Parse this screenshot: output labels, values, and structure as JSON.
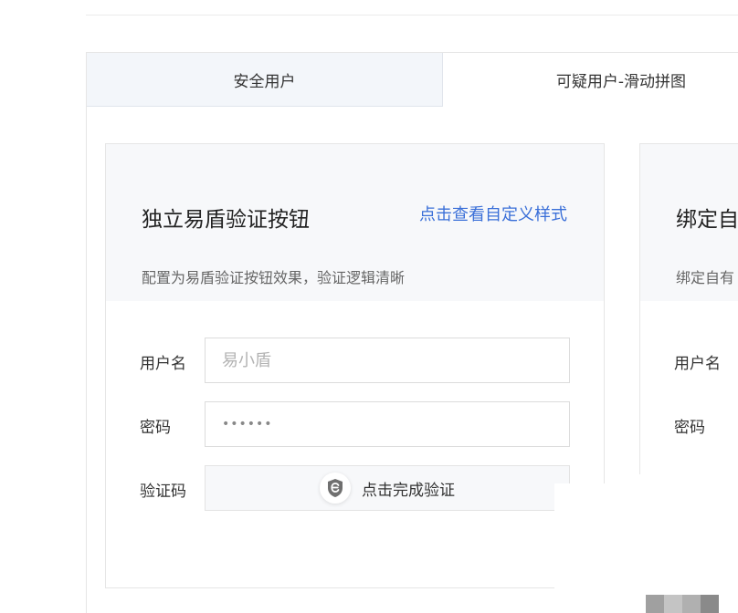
{
  "tabs": {
    "safe_user": "安全用户",
    "suspect_user": "可疑用户-滑动拼图"
  },
  "card1": {
    "title": "独立易盾验证按钮",
    "link": "点击查看自定义样式",
    "description": "配置为易盾验证按钮效果，验证逻辑清晰",
    "username_label": "用户名",
    "username_placeholder": "易小盾",
    "password_label": "密码",
    "password_value": "••••••",
    "captcha_label": "验证码",
    "captcha_button_text": "点击完成验证",
    "captcha_icon": "shield-e-icon"
  },
  "card2": {
    "title": "绑定自",
    "description": "绑定自有",
    "username_label": "用户名",
    "password_label": "密码"
  },
  "colors": {
    "accent_link": "#3a6fd8",
    "tab_active_bg": "#f3f6fa",
    "card_head_bg": "#f7f8fa"
  }
}
